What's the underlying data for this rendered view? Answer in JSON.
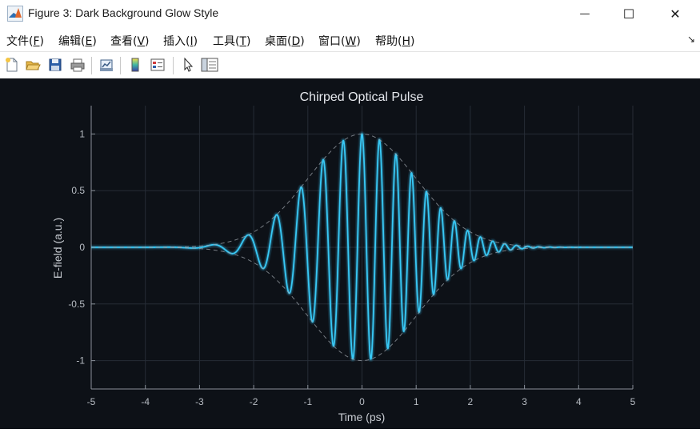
{
  "window": {
    "title": "Figure 3: Dark Background Glow Style",
    "minimize_glyph": "—",
    "maximize_glyph": "☐",
    "close_glyph": "✕"
  },
  "menu": {
    "items": [
      {
        "label": "文件(",
        "acc": "F",
        "end": ")"
      },
      {
        "label": "编辑(",
        "acc": "E",
        "end": ")"
      },
      {
        "label": "查看(",
        "acc": "V",
        "end": ")"
      },
      {
        "label": "插入(",
        "acc": "I",
        "end": ")"
      },
      {
        "label": "工具(",
        "acc": "T",
        "end": ")"
      },
      {
        "label": "桌面(",
        "acc": "D",
        "end": ")"
      },
      {
        "label": "窗口(",
        "acc": "W",
        "end": ")"
      },
      {
        "label": "帮助(",
        "acc": "H",
        "end": ")"
      }
    ],
    "overflow_glyph": "↘"
  },
  "toolbar": {
    "icons": [
      "new-figure-icon",
      "open-folder-icon",
      "save-icon",
      "print-icon",
      "link-plot-icon",
      "colorbar-icon",
      "legend-icon",
      "pointer-icon",
      "property-inspector-icon"
    ]
  },
  "chart_data": {
    "type": "line",
    "title": "Chirped Optical Pulse",
    "xlabel": "Time (ps)",
    "ylabel": "E-field (a.u.)",
    "xlim": [
      -5,
      5
    ],
    "ylim": [
      -1.25,
      1.25
    ],
    "xticks": [
      -5,
      -4,
      -3,
      -2,
      -1,
      0,
      1,
      2,
      3,
      4,
      5
    ],
    "xtick_labels": [
      "-5",
      "-4",
      "-3",
      "-2",
      "-1",
      "0",
      "1",
      "2",
      "3",
      "4",
      "5"
    ],
    "yticks": [
      -1,
      -0.5,
      0,
      0.5,
      1
    ],
    "ytick_labels": [
      "-1",
      "-0.5",
      "0",
      "0.5",
      "1"
    ],
    "grid": true,
    "background": "#0d1117",
    "series": [
      {
        "style": "solid",
        "color": "#38c8f5",
        "glow": true,
        "formula": "exp(-t^2/2) * cos(2*pi*(3*t + 0.3*t^2))"
      },
      {
        "style": "dashed",
        "color": "#9aa0a8",
        "formula": "exp(-t^2/2)"
      },
      {
        "style": "dashed",
        "color": "#9aa0a8",
        "formula": "-exp(-t^2/2)"
      }
    ]
  }
}
